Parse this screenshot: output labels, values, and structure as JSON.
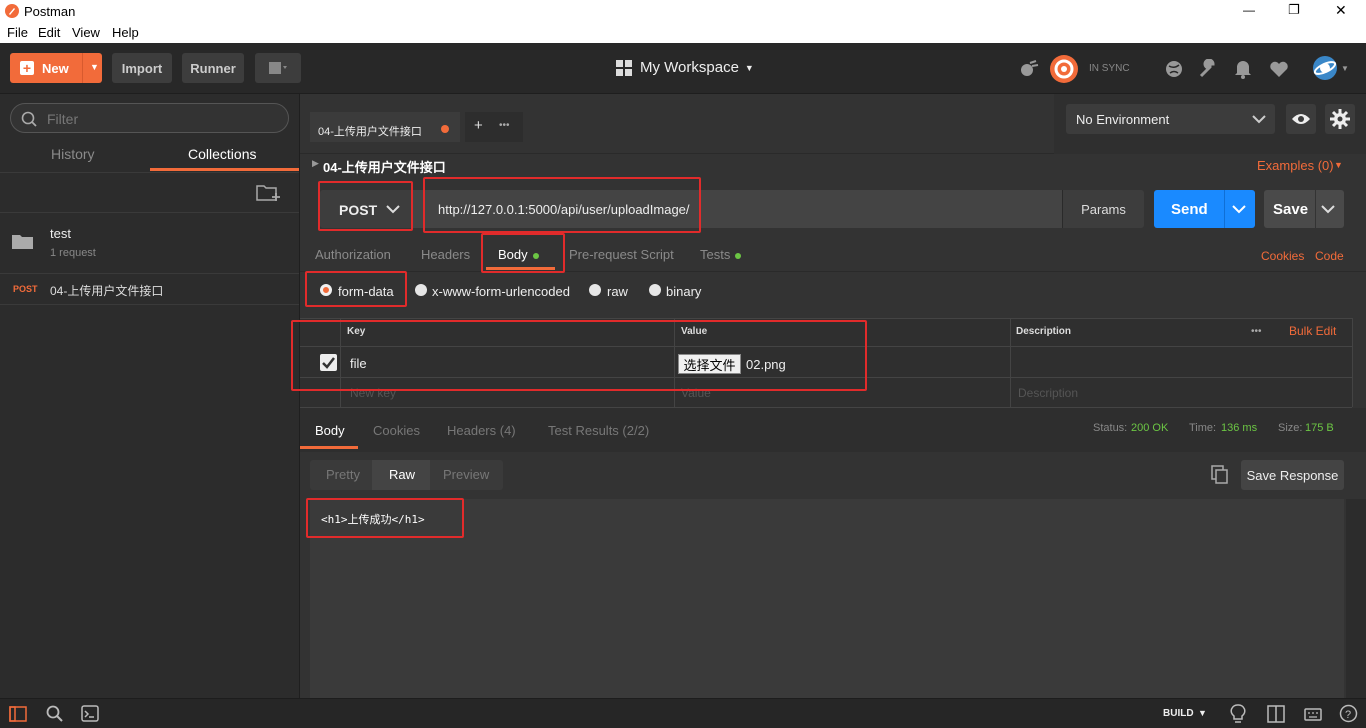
{
  "window": {
    "title": "Postman",
    "controls": {
      "minimize": "—",
      "maximize": "❐",
      "close": "✕"
    }
  },
  "menu": [
    "File",
    "Edit",
    "View",
    "Help"
  ],
  "toolbar": {
    "new_label": "New",
    "import_label": "Import",
    "runner_label": "Runner",
    "workspace_label": "My Workspace",
    "sync_label": "IN SYNC"
  },
  "sidebar": {
    "filter_placeholder": "Filter",
    "tabs": [
      "History",
      "Collections"
    ],
    "active_tab": "Collections",
    "collection": {
      "name": "test",
      "count": "1 request"
    },
    "request": {
      "method": "POST",
      "name": "04-上传用户文件接口"
    }
  },
  "tabs": {
    "active_tab_label": "04-上传用户文件接口",
    "add_label": "+",
    "more_label": "•••"
  },
  "environment": {
    "selected": "No Environment"
  },
  "request": {
    "title": "04-上传用户文件接口",
    "examples_label": "Examples (0)",
    "method": "POST",
    "url": "http://127.0.0.1:5000/api/user/uploadImage/",
    "params_label": "Params",
    "send_label": "Send",
    "save_label": "Save",
    "subtabs": [
      "Authorization",
      "Headers",
      "Body",
      "Pre-request Script",
      "Tests"
    ],
    "active_subtab": "Body",
    "cookies_label": "Cookies",
    "code_label": "Code",
    "body_modes": [
      "form-data",
      "x-www-form-urlencoded",
      "raw",
      "binary"
    ],
    "selected_mode": "form-data",
    "table": {
      "headers": [
        "Key",
        "Value",
        "Description"
      ],
      "bulk_edit": "Bulk Edit",
      "more": "•••",
      "rows": [
        {
          "key": "file",
          "file_button": "选择文件",
          "file_name": "02.png",
          "checked": true
        }
      ],
      "placeholder": {
        "key": "New key",
        "value": "Value",
        "description": "Description"
      }
    }
  },
  "response": {
    "tabs": [
      "Body",
      "Cookies",
      "Headers (4)",
      "Test Results (2/2)"
    ],
    "active_tab": "Body",
    "status_label": "Status:",
    "status_value": "200 OK",
    "time_label": "Time:",
    "time_value": "136 ms",
    "size_label": "Size:",
    "size_value": "175 B",
    "view_modes": [
      "Pretty",
      "Raw",
      "Preview"
    ],
    "active_view": "Raw",
    "save_response_label": "Save Response",
    "body_text": "<h1>上传成功</h1>"
  },
  "statusbar": {
    "build_label": "BUILD"
  },
  "colors": {
    "accent": "#f26b3a",
    "send": "#1a8aff",
    "success": "#6cc644",
    "highlight": "#e12b2b"
  }
}
